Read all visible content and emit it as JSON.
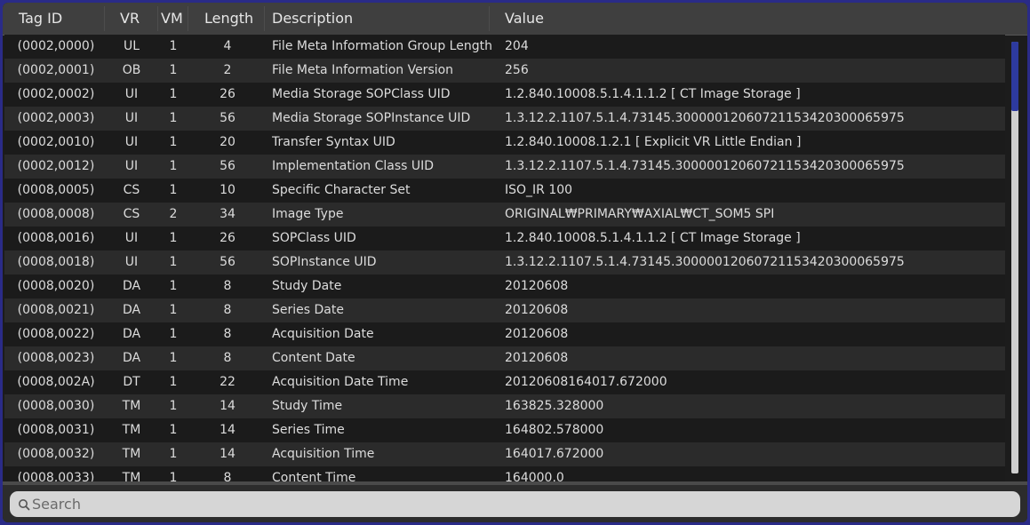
{
  "columns": {
    "tag": "Tag ID",
    "vr": "VR",
    "vm": "VM",
    "length": "Length",
    "description": "Description",
    "value": "Value"
  },
  "rows": [
    {
      "tag": "(0002,0000)",
      "vr": "UL",
      "vm": "1",
      "length": "4",
      "description": "File Meta Information Group Length",
      "value": "204"
    },
    {
      "tag": "(0002,0001)",
      "vr": "OB",
      "vm": "1",
      "length": "2",
      "description": "File Meta Information Version",
      "value": "256"
    },
    {
      "tag": "(0002,0002)",
      "vr": "UI",
      "vm": "1",
      "length": "26",
      "description": "Media Storage SOPClass UID",
      "value": "1.2.840.10008.5.1.4.1.1.2 [ CT Image Storage ]"
    },
    {
      "tag": "(0002,0003)",
      "vr": "UI",
      "vm": "1",
      "length": "56",
      "description": "Media Storage SOPInstance UID",
      "value": "1.3.12.2.1107.5.1.4.73145.30000012060721153420300065975"
    },
    {
      "tag": "(0002,0010)",
      "vr": "UI",
      "vm": "1",
      "length": "20",
      "description": "Transfer Syntax UID",
      "value": "1.2.840.10008.1.2.1 [ Explicit VR Little Endian ]"
    },
    {
      "tag": "(0002,0012)",
      "vr": "UI",
      "vm": "1",
      "length": "56",
      "description": "Implementation Class UID",
      "value": "1.3.12.2.1107.5.1.4.73145.30000012060721153420300065975"
    },
    {
      "tag": "(0008,0005)",
      "vr": "CS",
      "vm": "1",
      "length": "10",
      "description": "Specific Character Set",
      "value": "ISO_IR 100"
    },
    {
      "tag": "(0008,0008)",
      "vr": "CS",
      "vm": "2",
      "length": "34",
      "description": "Image Type",
      "value": "ORIGINAL₩PRIMARY₩AXIAL₩CT_SOM5 SPI"
    },
    {
      "tag": "(0008,0016)",
      "vr": "UI",
      "vm": "1",
      "length": "26",
      "description": "SOPClass UID",
      "value": "1.2.840.10008.5.1.4.1.1.2 [ CT Image Storage ]"
    },
    {
      "tag": "(0008,0018)",
      "vr": "UI",
      "vm": "1",
      "length": "56",
      "description": "SOPInstance UID",
      "value": "1.3.12.2.1107.5.1.4.73145.30000012060721153420300065975"
    },
    {
      "tag": "(0008,0020)",
      "vr": "DA",
      "vm": "1",
      "length": "8",
      "description": "Study Date",
      "value": "20120608"
    },
    {
      "tag": "(0008,0021)",
      "vr": "DA",
      "vm": "1",
      "length": "8",
      "description": "Series Date",
      "value": "20120608"
    },
    {
      "tag": "(0008,0022)",
      "vr": "DA",
      "vm": "1",
      "length": "8",
      "description": "Acquisition Date",
      "value": "20120608"
    },
    {
      "tag": "(0008,0023)",
      "vr": "DA",
      "vm": "1",
      "length": "8",
      "description": "Content Date",
      "value": "20120608"
    },
    {
      "tag": "(0008,002A)",
      "vr": "DT",
      "vm": "1",
      "length": "22",
      "description": "Acquisition Date Time",
      "value": "20120608164017.672000"
    },
    {
      "tag": "(0008,0030)",
      "vr": "TM",
      "vm": "1",
      "length": "14",
      "description": "Study Time",
      "value": "163825.328000"
    },
    {
      "tag": "(0008,0031)",
      "vr": "TM",
      "vm": "1",
      "length": "14",
      "description": "Series Time",
      "value": "164802.578000"
    },
    {
      "tag": "(0008,0032)",
      "vr": "TM",
      "vm": "1",
      "length": "14",
      "description": "Acquisition Time",
      "value": "164017.672000"
    },
    {
      "tag": "(0008,0033)",
      "vr": "TM",
      "vm": "1",
      "length": "8",
      "description": "Content Time",
      "value": "164000.0"
    }
  ],
  "scroll": {
    "position_fraction": 0.0,
    "visible_fraction": 0.16
  },
  "search": {
    "placeholder": "Search",
    "value": "",
    "icon": "search-icon"
  },
  "colors": {
    "scroll_thumb": "#2d3a9e",
    "window_border": "#2a2b88"
  }
}
